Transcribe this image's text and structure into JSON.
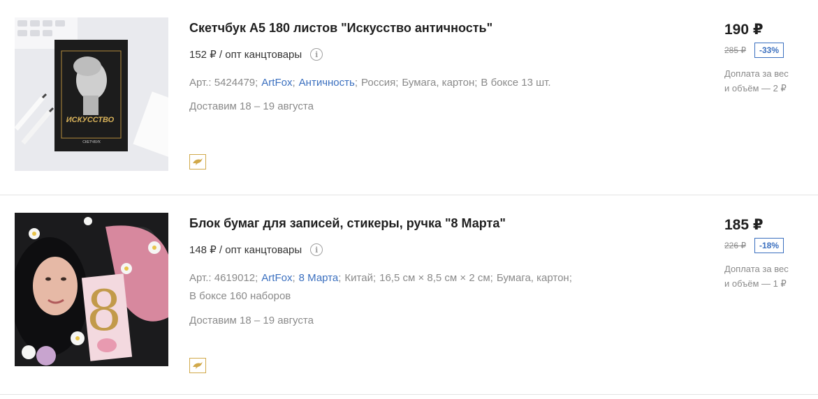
{
  "products": [
    {
      "title": "Скетчбук А5 180 листов \"Искусство античность\"",
      "opt_price": "152 ₽ / опт канцтовары",
      "art_label": "Арт.: 5424479;",
      "brand": "ArtFox",
      "series": "Античность",
      "details": [
        "Россия;",
        "Бумага, картон;",
        "В боксе 13 шт."
      ],
      "cover_text": "ИСКУССТВО",
      "cover_sub": "СКЕТЧБУК",
      "delivery": "Доставим 18 – 19 августа",
      "price": "190 ₽",
      "old_price": "285 ₽",
      "discount": "-33%",
      "extra_line1": "Доплата за вес",
      "extra_line2": "и объём — 2 ₽"
    },
    {
      "title": "Блок бумаг для записей, стикеры, ручка \"8 Марта\"",
      "opt_price": "148 ₽ / опт канцтовары",
      "art_label": "Арт.: 4619012;",
      "brand": "ArtFox",
      "series": "8 Марта",
      "details": [
        "Китай;",
        "16,5 см × 8,5 см × 2 см;",
        "Бумага, картон;",
        "В боксе 160 наборов"
      ],
      "cover_text": "8",
      "delivery": "Доставим 18 – 19 августа",
      "price": "185 ₽",
      "old_price": "226 ₽",
      "discount": "-18%",
      "extra_line1": "Доплата за вес",
      "extra_line2": "и объём — 1 ₽"
    }
  ],
  "icons": {
    "info": "info-icon",
    "dolphin": "dolphin-icon"
  },
  "colors": {
    "link": "#3a6fbf",
    "badge_border": "#d1a94a"
  }
}
